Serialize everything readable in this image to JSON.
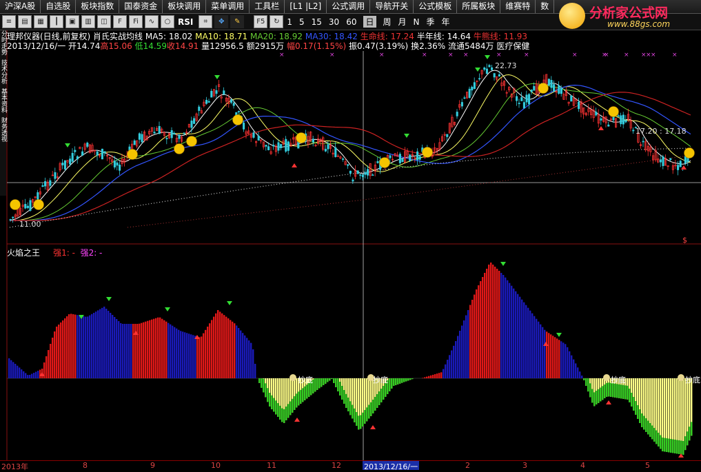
{
  "menubar": {
    "items": [
      "沪深A股",
      "自选股",
      "板块指数",
      "国泰资金",
      "板块调用",
      "菜单调用",
      "工具栏",
      "[L1 |L2]",
      "公式调用",
      "导航开关",
      "公式模板",
      "所属板块",
      "维赛特",
      "数"
    ]
  },
  "toolbar": {
    "icons": [
      "stock-list-icon",
      "chart-icon",
      "grid-icon",
      "candle-icon",
      "tile-icon",
      "bar-icon",
      "split-icon",
      "f10-icon",
      "fiz-icon",
      "wave-icon",
      "circle-icon"
    ],
    "rsi_label": "RSI",
    "f5_label": "F5",
    "periods": [
      "1",
      "5",
      "15",
      "30",
      "60"
    ],
    "timeframes": [
      "日",
      "周",
      "月",
      "N",
      "季",
      "年"
    ],
    "active_timeframe": "日"
  },
  "logo": {
    "text": "分析家公式网",
    "url": "www.88gs.com"
  },
  "sidetabs": [
    "分时走势",
    "技术分析",
    "基本资料",
    "财务透视"
  ],
  "price_panel": {
    "header_name": "理邦仪器(日线,前复权)",
    "header_indicator": "肖氏实战均线",
    "ma5": "MA5: 18.02",
    "ma10": "MA10: 18.71",
    "ma20": "MA20: 18.92",
    "ma30": "MA30: 18.42",
    "lifeline": "生命线: 17.24",
    "halfyear": "半年线: 14.64",
    "bull": "牛熊线: 11.93",
    "date": "2013/12/16/一",
    "open": "开14.74",
    "high": "高15.06",
    "low": "低14.59",
    "close": "收14.91",
    "volume": "量12956.5",
    "amount": "额2915万",
    "change": "幅0.17(1.15%)",
    "amplitude": "振0.47(3.19%)",
    "turnover": "换2.36%",
    "float_shares": "流通5484万",
    "sector": "医疗保健",
    "high_mark": "22.73",
    "low_mark": "11.00",
    "price_marks": "17.20 : 17.18",
    "dollar_mark": "$"
  },
  "indicator_panel": {
    "name": "火焰之王",
    "strong1": "强1: -",
    "strong2": "强2: -",
    "bottom_label": "抄底"
  },
  "time_axis": {
    "labels": [
      "2013年",
      "8",
      "9",
      "10",
      "11",
      "12",
      "2",
      "3",
      "4",
      "5"
    ],
    "crosshair_date": "2013/12/16/一"
  },
  "colors": {
    "up": "#ff3333",
    "down": "#33ccdd",
    "ma5": "#ffffff",
    "ma10": "#ffff66",
    "ma20": "#66cc33",
    "ma30": "#3355ff",
    "lifeline": "#cc2222",
    "red_bar": "#e01818",
    "blue_bar": "#1a1ab8",
    "yellow_bar": "#ffff88",
    "green_bar": "#33cc22"
  }
}
